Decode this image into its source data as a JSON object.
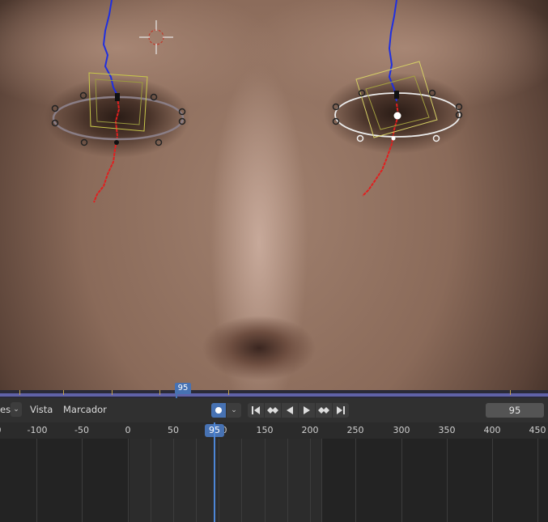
{
  "viewport": {
    "scrub_frame": "95"
  },
  "header": {
    "menus": [
      "es",
      "Vista",
      "Marcador"
    ],
    "frame_value": "95"
  },
  "ruler": {
    "labels": [
      "0",
      "-100",
      "-50",
      "0",
      "50",
      "100",
      "150",
      "200",
      "250",
      "300",
      "350",
      "400",
      "450"
    ],
    "current_frame": "95"
  },
  "icons": {
    "record": "record-icon",
    "dropdown": "chevron-down-icon",
    "transport": [
      "jump-to-start-icon",
      "prev-keyframe-icon",
      "play-reverse-icon",
      "play-icon",
      "next-keyframe-icon",
      "jump-to-end-icon"
    ]
  },
  "colors": {
    "accent": "#4772b3",
    "track_red": "#e01f1f",
    "track_blue": "#1f2fe0",
    "scrub_bar": "#6062a8"
  }
}
